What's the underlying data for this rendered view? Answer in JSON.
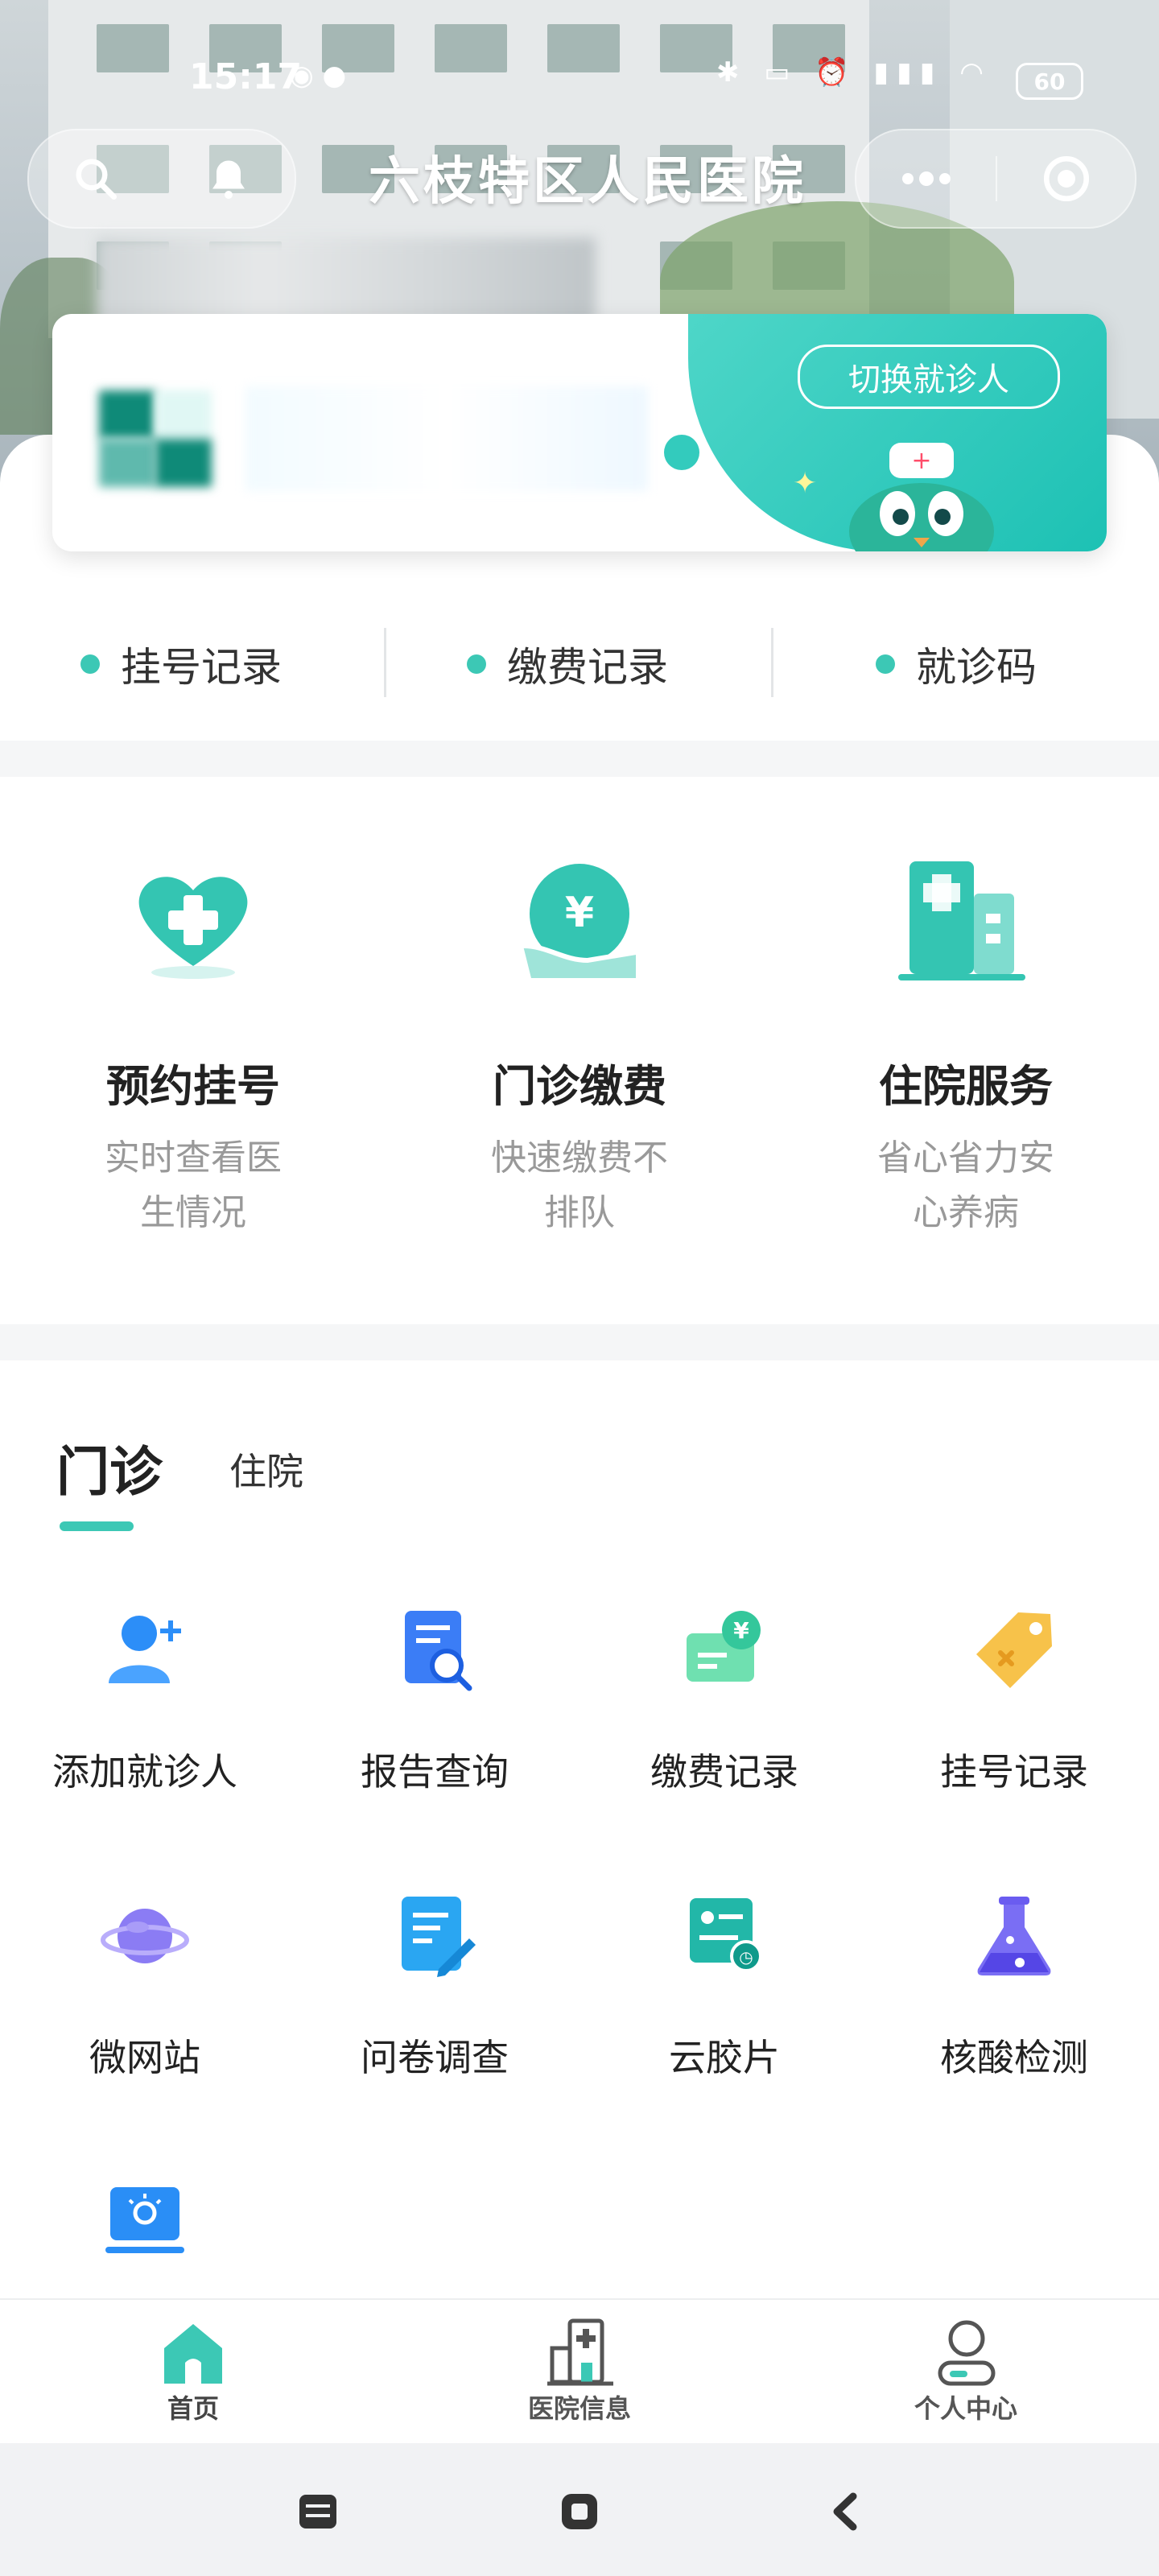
{
  "status": {
    "time": "15:17",
    "battery": "60"
  },
  "header": {
    "title": "六枝特区人民医院"
  },
  "patient_card": {
    "switch_label": "切换就诊人"
  },
  "quick_links": [
    {
      "label": "挂号记录"
    },
    {
      "label": "缴费记录"
    },
    {
      "label": "就诊码"
    }
  ],
  "services": [
    {
      "title": "预约挂号",
      "desc": "实时查看医生情况",
      "icon": "heart-plus-icon"
    },
    {
      "title": "门诊缴费",
      "desc": "快速缴费不排队",
      "icon": "yuan-hand-icon"
    },
    {
      "title": "住院服务",
      "desc": "省心省力安心养病",
      "icon": "hospital-building-icon"
    }
  ],
  "tabs": {
    "active": "门诊",
    "other": "住院"
  },
  "grid_items": [
    {
      "label": "添加就诊人",
      "icon": "add-user-icon",
      "color": "#2c8ef8"
    },
    {
      "label": "报告查询",
      "icon": "report-search-icon",
      "color": "#3b7df6"
    },
    {
      "label": "缴费记录",
      "icon": "payment-card-icon",
      "color": "#34c79b"
    },
    {
      "label": "挂号记录",
      "icon": "tag-icon",
      "color": "#f7b733"
    },
    {
      "label": "微网站",
      "icon": "planet-icon",
      "color": "#7b6cf0"
    },
    {
      "label": "问卷调查",
      "icon": "survey-icon",
      "color": "#2aa6f2"
    },
    {
      "label": "云胶片",
      "icon": "cloud-film-icon",
      "color": "#22b7a8"
    },
    {
      "label": "核酸检测",
      "icon": "flask-icon",
      "color": "#6a5cf0"
    },
    {
      "label": "",
      "icon": "monitor-icon",
      "color": "#2a8ef6"
    }
  ],
  "bottom_tabs": [
    {
      "label": "首页",
      "icon": "home-icon"
    },
    {
      "label": "医院信息",
      "icon": "hospital-icon"
    },
    {
      "label": "个人中心",
      "icon": "user-icon"
    }
  ],
  "colors": {
    "accent": "#3cc8b5"
  }
}
